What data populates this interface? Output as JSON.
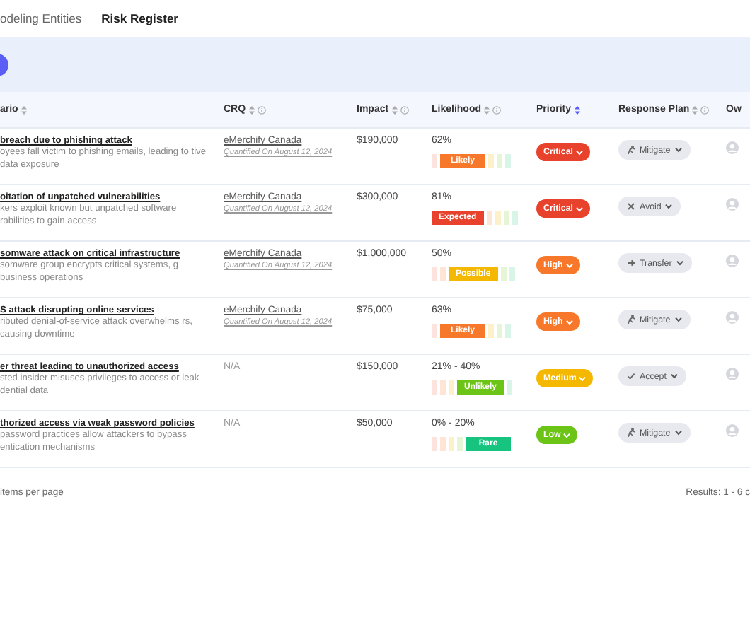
{
  "tabs": [
    {
      "label": "odeling Entities",
      "selected": false
    },
    {
      "label": "Risk Register",
      "selected": true
    }
  ],
  "columns": [
    {
      "label": "ario",
      "sorted": false
    },
    {
      "label": "CRQ",
      "sorted": false,
      "info": true
    },
    {
      "label": "Impact",
      "sorted": false,
      "info": true
    },
    {
      "label": "Likelihood",
      "sorted": false,
      "info": true
    },
    {
      "label": "Priority",
      "sorted": true
    },
    {
      "label": "Response Plan",
      "sorted": false,
      "info": true
    },
    {
      "label": "Ow"
    }
  ],
  "rows": [
    {
      "title": "breach due to phishing attack",
      "description": "oyees fall victim to phishing emails, leading to tive data exposure",
      "crq": {
        "entity": "eMerchify Canada",
        "date": "Quantified On August 12, 2024"
      },
      "impact": "$190,000",
      "likelihood": {
        "reading": "62%",
        "label": "Likely",
        "kind": "likely"
      },
      "priority": {
        "label": "Critical",
        "kind": "critical"
      },
      "response": {
        "label": "Mitigate",
        "kind": "mitigate"
      }
    },
    {
      "title": "oitation of unpatched vulnerabilities",
      "description": "kers exploit known but unpatched software rabilities to gain access",
      "crq": {
        "entity": "eMerchify Canada",
        "date": "Quantified On August 12, 2024"
      },
      "impact": "$300,000",
      "likelihood": {
        "reading": "81%",
        "label": "Expected",
        "kind": "expected"
      },
      "priority": {
        "label": "Critical",
        "kind": "critical"
      },
      "response": {
        "label": "Avoid",
        "kind": "avoid"
      }
    },
    {
      "title": "somware attack on critical infrastructure",
      "description": "somware group encrypts critical systems, g business operations",
      "crq": {
        "entity": "eMerchify Canada",
        "date": "Quantified On August 12, 2024"
      },
      "impact": "$1,000,000",
      "likelihood": {
        "reading": "50%",
        "label": "Possible",
        "kind": "possible"
      },
      "priority": {
        "label": "High",
        "kind": "high"
      },
      "response": {
        "label": "Transfer",
        "kind": "transfer"
      }
    },
    {
      "title": "S attack disrupting online services",
      "description": "ributed denial-of-service attack overwhelms rs, causing downtime",
      "crq": {
        "entity": "eMerchify Canada",
        "date": "Quantified On August 12, 2024"
      },
      "impact": "$75,000",
      "likelihood": {
        "reading": "63%",
        "label": "Likely",
        "kind": "likely"
      },
      "priority": {
        "label": "High",
        "kind": "high"
      },
      "response": {
        "label": "Mitigate",
        "kind": "mitigate"
      }
    },
    {
      "title": "er threat leading to unauthorized access",
      "description": "sted insider misuses privileges to access or leak dential data",
      "crq": {
        "na": "N/A"
      },
      "impact": "$150,000",
      "likelihood": {
        "reading": "21% - 40%",
        "label": "Unlikely",
        "kind": "unlikely"
      },
      "priority": {
        "label": "Medium",
        "kind": "medium"
      },
      "response": {
        "label": "Accept",
        "kind": "accept"
      }
    },
    {
      "title": "thorized access via weak password policies",
      "description": "password practices allow attackers to bypass entication mechanisms",
      "crq": {
        "na": "N/A"
      },
      "impact": "$50,000",
      "likelihood": {
        "reading": "0% - 20%",
        "label": "Rare",
        "kind": "rare"
      },
      "priority": {
        "label": "Low",
        "kind": "low"
      },
      "response": {
        "label": "Mitigate",
        "kind": "mitigate"
      }
    }
  ],
  "footer": {
    "per_page": "items  per page",
    "results": "Results:  1 - 6 c"
  }
}
